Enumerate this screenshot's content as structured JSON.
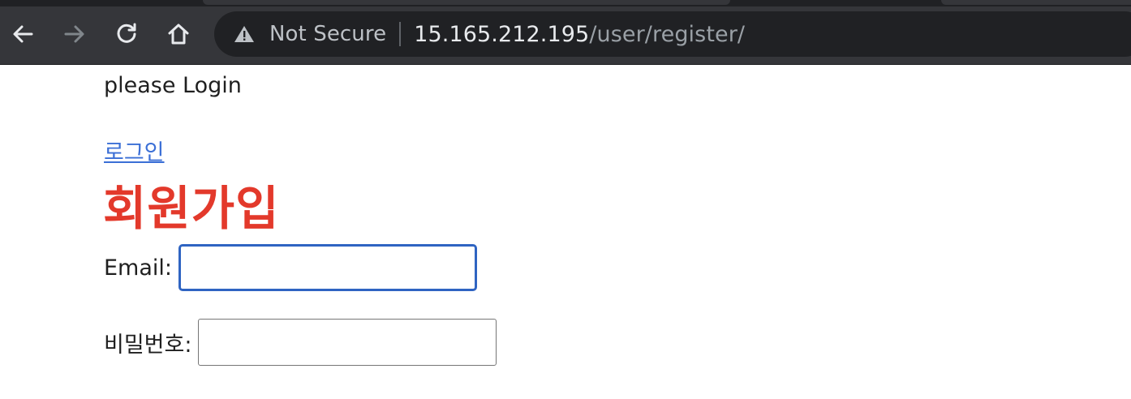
{
  "browser": {
    "nav": {
      "back_icon": "arrow-left-icon",
      "forward_icon": "arrow-right-icon",
      "reload_icon": "reload-icon",
      "home_icon": "home-icon"
    },
    "address_bar": {
      "security_icon": "warning-triangle-icon",
      "security_label": "Not Secure",
      "host": "15.165.212.195",
      "path": "/user/register/"
    }
  },
  "page": {
    "login_message": "please Login",
    "login_link": "로그인",
    "heading": "회원가입",
    "form": {
      "email_label": "Email:",
      "email_value": "",
      "password_label": "비밀번호:",
      "password_value": ""
    }
  },
  "colors": {
    "heading": "#e3392b",
    "link": "#3b6fd6",
    "focus_border": "#2f64c2",
    "chrome_bg": "#35363a",
    "omnibox_bg": "#202124"
  }
}
